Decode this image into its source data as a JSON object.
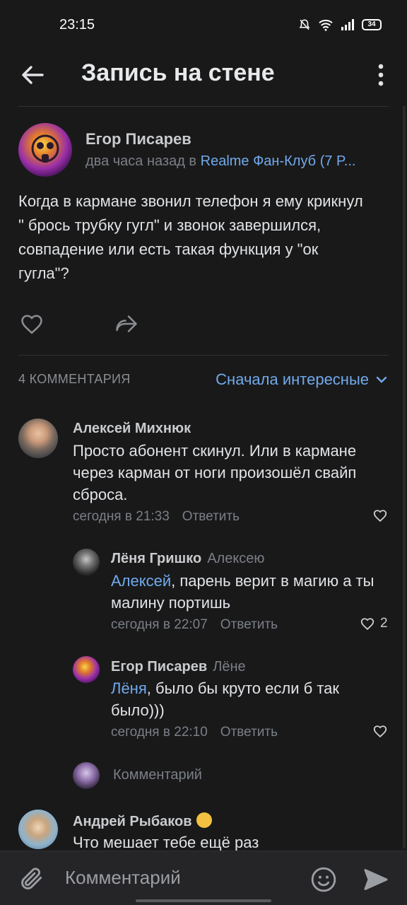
{
  "status_bar": {
    "time": "23:15",
    "battery": "34"
  },
  "header": {
    "title": "Запись на стене"
  },
  "post": {
    "author": "Егор Писарев",
    "meta_time": "два часа назад в ",
    "group": "Realme Фан-Клуб (7 P...",
    "text": "Когда в кармане звонил телефон я ему крикнул \" брось трубку гугл\" и звонок завершился, совпадение или есть такая функция у \"ок гугла\"?"
  },
  "comments_header": {
    "count_label": "4 КОММЕНТАРИЯ",
    "sort_label": "Сначала интересные"
  },
  "comments": [
    {
      "author": "Алексей Михнюк",
      "text": "Просто абонент скинул. Или в кармане через карман от ноги произошёл свайп сброса.",
      "time": "сегодня в 21:33",
      "reply_label": "Ответить"
    },
    {
      "author": "Лёня Гришко",
      "reply_to": "Алексею",
      "mention": "Алексей",
      "text": ", парень верит в магию а ты малину портишь",
      "time": "сегодня в 22:07",
      "reply_label": "Ответить",
      "likes": "2"
    },
    {
      "author": "Егор Писарев",
      "reply_to": "Лёне",
      "mention": "Лёня",
      "text": ", было бы круто если б так было)))",
      "time": "сегодня в 22:10",
      "reply_label": "Ответить"
    },
    {
      "author": "Андрей Рыбаков",
      "text": "Что мешает тебе ещё раз"
    }
  ],
  "thread_reply": {
    "placeholder": "Комментарий"
  },
  "bottom_bar": {
    "placeholder": "Комментарий"
  },
  "colors": {
    "background": "#19191a",
    "accent": "#71aaeb",
    "secondary_text": "#7b7f86"
  }
}
